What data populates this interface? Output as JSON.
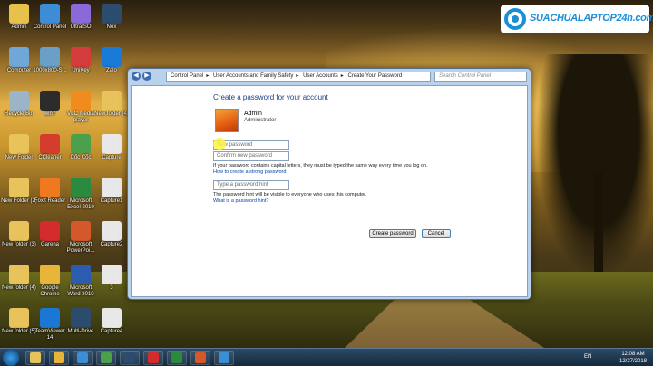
{
  "brand": {
    "text": "SUACHUALAPTOP24h.com"
  },
  "desktop_icons": [
    {
      "label": "Admin",
      "color": "#e7c24a"
    },
    {
      "label": "Control Panel",
      "color": "#3c8cd6"
    },
    {
      "label": "UltraISO",
      "color": "#8a6ad8"
    },
    {
      "label": "Nox",
      "color": "#2b4c6c"
    },
    {
      "label": "Computer",
      "color": "#6fa7d8"
    },
    {
      "label": "1000x800-S...",
      "color": "#6aa0c8"
    },
    {
      "label": "UniKey",
      "color": "#d43c3c"
    },
    {
      "label": "Zalo",
      "color": "#1a7ad8"
    },
    {
      "label": "Recycle Bin",
      "color": "#9cb4c8"
    },
    {
      "label": "win7",
      "color": "#2c2c2c"
    },
    {
      "label": "VLC media player",
      "color": "#f08c1e"
    },
    {
      "label": "New folder (4)",
      "color": "#e8c25a"
    },
    {
      "label": "New Folder",
      "color": "#e8c25a"
    },
    {
      "label": "CCleaner",
      "color": "#d43c2c"
    },
    {
      "label": "Cốc Cốc",
      "color": "#4ca04c"
    },
    {
      "label": "Capture",
      "color": "#e8e8e8"
    },
    {
      "label": "New Folder (2)",
      "color": "#e8c25a"
    },
    {
      "label": "Foxit Reader",
      "color": "#f0781e"
    },
    {
      "label": "Microsoft Excel 2010",
      "color": "#2a8a3e"
    },
    {
      "label": "Capture1",
      "color": "#e8e8e8"
    },
    {
      "label": "New folder (3)",
      "color": "#e8c25a"
    },
    {
      "label": "Garena",
      "color": "#d42c2c"
    },
    {
      "label": "Microsoft PowerPoi...",
      "color": "#d4582c"
    },
    {
      "label": "Capture2",
      "color": "#e8e8e8"
    },
    {
      "label": "New folder (4)",
      "color": "#e8c25a"
    },
    {
      "label": "Google Chrome",
      "color": "#e8b43a"
    },
    {
      "label": "Microsoft Word 2010",
      "color": "#2c5cb0"
    },
    {
      "label": "3",
      "color": "#e8e8e8"
    },
    {
      "label": "New folder (5)",
      "color": "#e8c25a"
    },
    {
      "label": "TeamViewer 14",
      "color": "#1a78d4"
    },
    {
      "label": "Multi-Drive",
      "color": "#2b4c6c"
    },
    {
      "label": "Capture4",
      "color": "#e8e8e8"
    }
  ],
  "window": {
    "breadcrumb": [
      "Control Panel",
      "User Accounts and Family Safety",
      "User Accounts",
      "Create Your Password"
    ],
    "search_placeholder": "Search Control Panel",
    "heading": "Create a password for your account",
    "user_name": "Admin",
    "user_role": "Administrator",
    "new_password_placeholder": "New password",
    "confirm_password_placeholder": "Confirm new password",
    "caps_note": "If your password contains capital letters, they must be typed the same way every time you log on.",
    "strong_link": "How to create a strong password",
    "hint_placeholder": "Type a password hint",
    "hint_note": "The password hint will be visible to everyone who uses this computer.",
    "hint_link": "What is a password hint?",
    "create_button": "Create password",
    "cancel_button": "Cancel"
  },
  "taskbar": {
    "items": [
      "explorer",
      "chrome",
      "media",
      "coccoc",
      "nox",
      "garena",
      "capture",
      "paint",
      "control-panel"
    ],
    "language": "EN",
    "time": "12:08 AM",
    "date": "12/27/2018"
  }
}
